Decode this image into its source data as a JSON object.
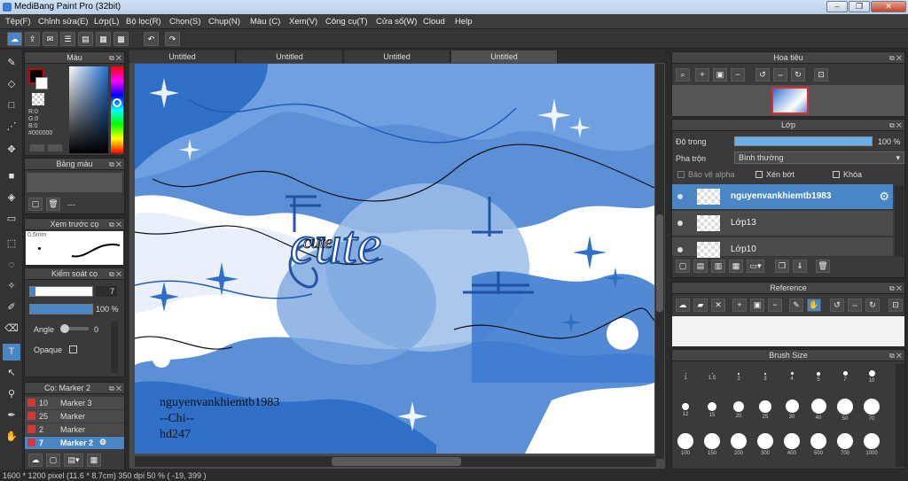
{
  "app": {
    "title": "MediBang Paint Pro (32bit)"
  },
  "window_buttons": {
    "minimize": "–",
    "restore": "❐",
    "close": "✕"
  },
  "menu": [
    "Tệp(F)",
    "Chỉnh sửa(E)",
    "Lớp(L)",
    "Bộ lọc(R)",
    "Chọn(S)",
    "Chụp(N)",
    "Màu (C)",
    "Xem(V)",
    "Công cụ(T)",
    "Cửa sổ(W)",
    "Cloud",
    "Help"
  ],
  "tabs": [
    "Untitled",
    "Untitled",
    "Untitled",
    "Untitled"
  ],
  "color_panel": {
    "title": "Màu",
    "readout": [
      "R:0",
      "G:0",
      "B:0",
      "#000000"
    ],
    "foreground": "#000000",
    "accent": "#cc0000"
  },
  "palette_panel": {
    "title": "Bảng màu",
    "dashes": "---"
  },
  "brush_preview": {
    "title": "Xem trước cọ",
    "size": "0.5mm"
  },
  "brush_control": {
    "title": "Kiểm soát cọ",
    "size_value": "7",
    "opacity_value": "100 %",
    "angle_label": "Angle",
    "angle_value": "0",
    "opaque_label": "Opaque"
  },
  "brush_list": {
    "title": "Cọ: Marker 2",
    "items": [
      {
        "size": "10",
        "name": "Marker 3"
      },
      {
        "size": "25",
        "name": "Marker"
      },
      {
        "size": "2",
        "name": "Marker"
      },
      {
        "size": "7",
        "name": "Marker 2"
      }
    ]
  },
  "navigator": {
    "title": "Hoa tiêu"
  },
  "layer_panel": {
    "title": "Lớp",
    "opacity_label": "Độ trong",
    "opacity_value": "100 %",
    "blend_label": "Pha trộn",
    "blend_value": "Bình thường",
    "protect_alpha": "Bảo vệ alpha",
    "clipping": "Xén bớt",
    "lock": "Khóa",
    "layers": [
      "nguyenvankhiemtb1983",
      "Lớp13",
      "Lớp10"
    ]
  },
  "reference_panel": {
    "title": "Reference"
  },
  "brush_size_panel": {
    "title": "Brush Size",
    "sizes": [
      "1",
      "1.5",
      "2",
      "3",
      "4",
      "5",
      "7",
      "10",
      "12",
      "15",
      "20",
      "25",
      "30",
      "40",
      "50",
      "70",
      "100",
      "150",
      "200",
      "300",
      "400",
      "500",
      "700",
      "1000"
    ]
  },
  "canvas_text": {
    "title_art": "cute",
    "credit_line1": "nguyenvankhiemtb1983",
    "credit_line2": "--Chi--",
    "credit_line3": "hd247"
  },
  "status": {
    "text": "1600 * 1200 pixel  (11.6 * 8.7cm)  350 dpi  50 %  ( -19, 399 )"
  },
  "colors": {
    "accent": "#4a86c5",
    "bg": "#2b2b2b",
    "canvas_blue": "#5b8fd6"
  }
}
